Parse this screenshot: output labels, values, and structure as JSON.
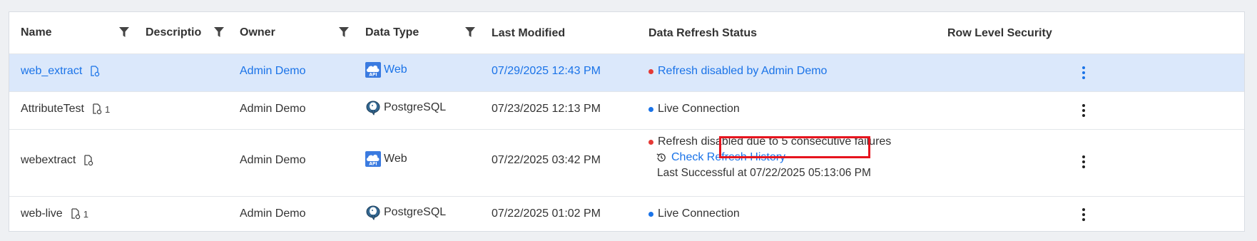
{
  "headers": {
    "name": "Name",
    "description": "Description",
    "owner": "Owner",
    "data_type": "Data Type",
    "last_modified": "Last Modified",
    "refresh_status": "Data Refresh Status",
    "row_level_security": "Row Level Security"
  },
  "rows": [
    {
      "name": "web_extract",
      "count": "",
      "owner": "Admin Demo",
      "data_type": "Web",
      "last_modified": "07/29/2025 12:43 PM",
      "status": "Refresh disabled by Admin Demo"
    },
    {
      "name": "AttributeTest",
      "count": "1",
      "owner": "Admin Demo",
      "data_type": "PostgreSQL",
      "last_modified": "07/23/2025 12:13 PM",
      "status": "Live Connection"
    },
    {
      "name": "webextract",
      "count": "",
      "owner": "Admin Demo",
      "data_type": "Web",
      "last_modified": "07/22/2025 03:42 PM",
      "status": "Refresh disabled due to 5 consecutive failures",
      "check_history": "Check Refresh History",
      "last_successful": "Last Successful at 07/22/2025 05:13:06 PM"
    },
    {
      "name": "web-live",
      "count": "1",
      "owner": "Admin Demo",
      "data_type": "PostgreSQL",
      "last_modified": "07/22/2025 01:02 PM",
      "status": "Live Connection"
    }
  ],
  "colors": {
    "selected_row": "#dbe8fb",
    "link": "#1a73e8",
    "status_red": "#e53935",
    "status_blue": "#1a73e8",
    "highlight": "#e6141e"
  }
}
